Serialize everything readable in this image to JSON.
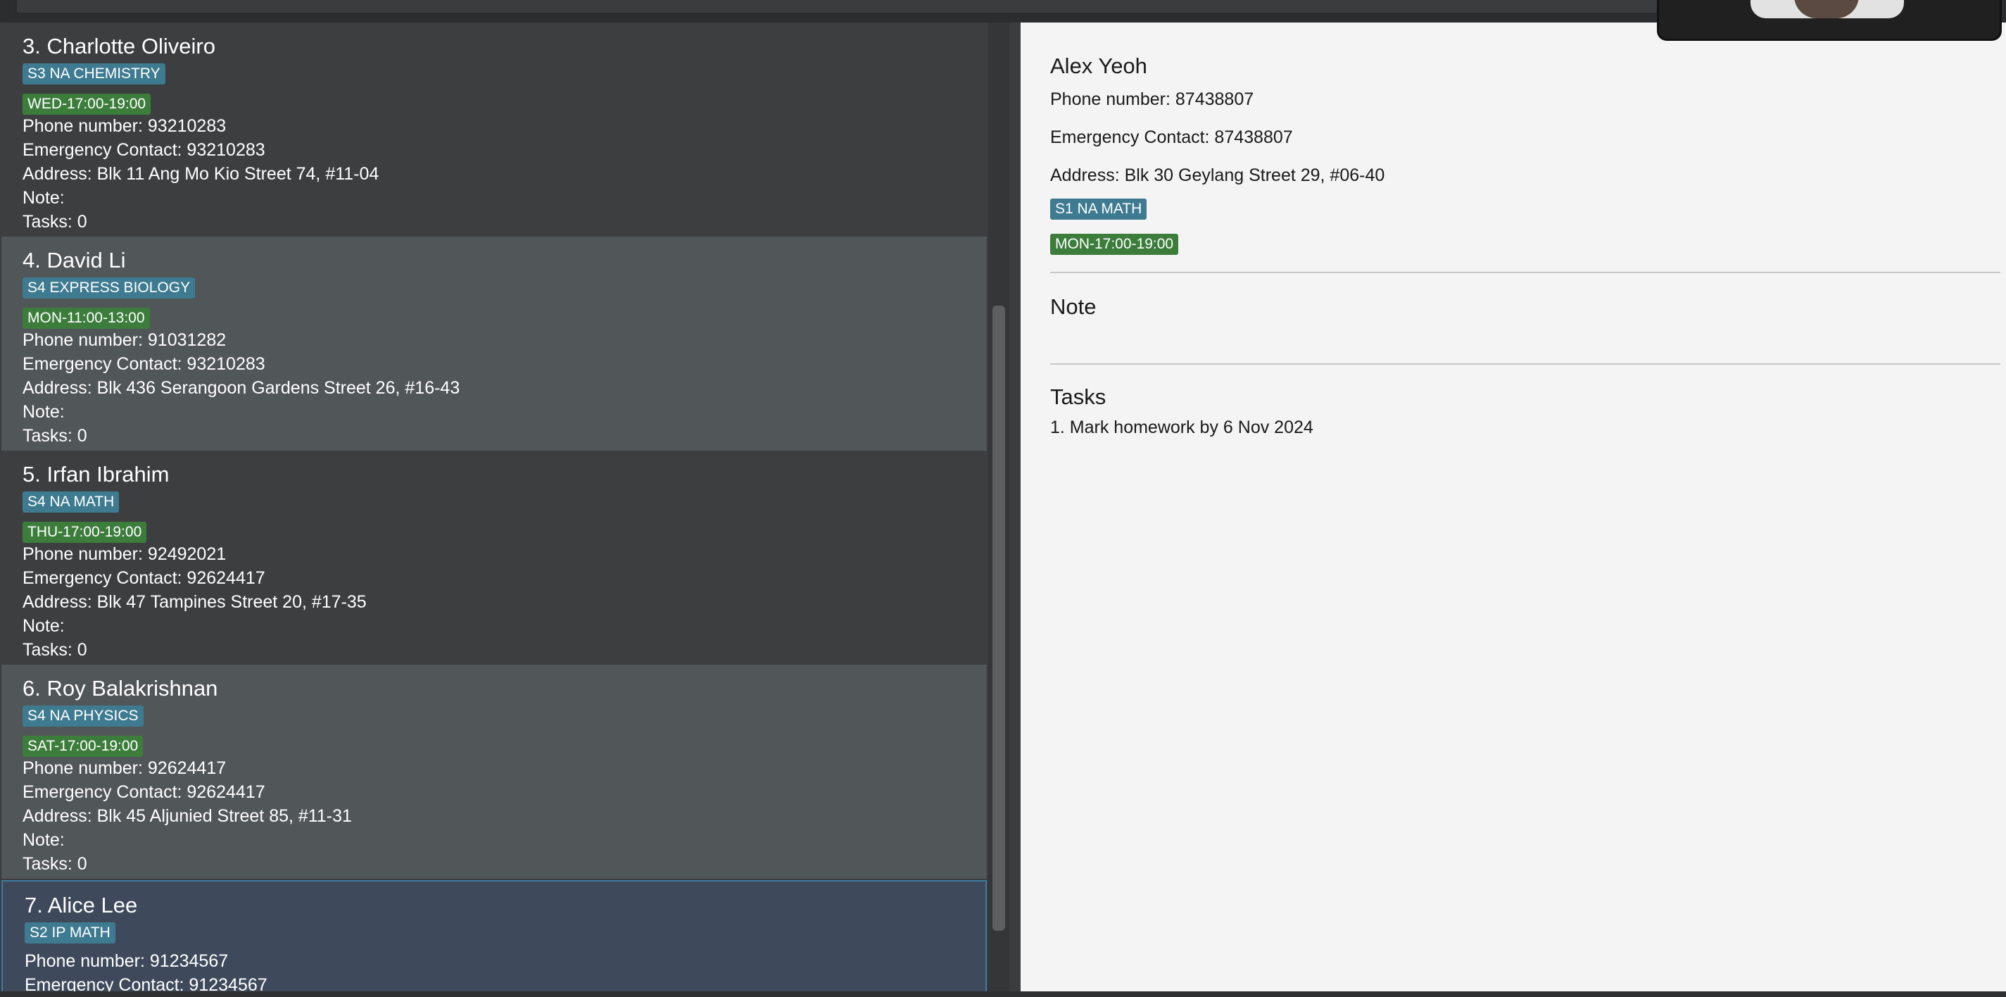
{
  "contacts": [
    {
      "name": "3. Charlotte Oliveiro",
      "subject": "S3 NA CHEMISTRY",
      "slot": "WED-17:00-19:00",
      "phone": "Phone number: 93210283",
      "emergency": "Emergency Contact: 93210283",
      "address": "Address: Blk 11 Ang Mo Kio Street 74, #11-04",
      "note": "Note:",
      "tasks": "Tasks: 0"
    },
    {
      "name": "4. David Li",
      "subject": "S4 EXPRESS BIOLOGY",
      "slot": "MON-11:00-13:00",
      "phone": "Phone number: 91031282",
      "emergency": "Emergency Contact: 93210283",
      "address": "Address: Blk 436 Serangoon Gardens Street 26, #16-43",
      "note": "Note:",
      "tasks": "Tasks: 0"
    },
    {
      "name": "5. Irfan Ibrahim",
      "subject": "S4 NA MATH",
      "slot": "THU-17:00-19:00",
      "phone": "Phone number: 92492021",
      "emergency": "Emergency Contact: 92624417",
      "address": "Address: Blk 47 Tampines Street 20, #17-35",
      "note": "Note:",
      "tasks": "Tasks: 0"
    },
    {
      "name": "6. Roy Balakrishnan",
      "subject": "S4 NA PHYSICS",
      "slot": "SAT-17:00-19:00",
      "phone": "Phone number: 92624417",
      "emergency": "Emergency Contact: 92624417",
      "address": "Address: Blk 45 Aljunied Street 85, #11-31",
      "note": "Note:",
      "tasks": "Tasks: 0"
    },
    {
      "name": "7. Alice Lee",
      "subject": "S2 IP MATH",
      "phone": "Phone number: 91234567",
      "emergency": "Emergency Contact: 91234567"
    }
  ],
  "detail": {
    "name": "Alex Yeoh",
    "phone": "Phone number: 87438807",
    "emergency": "Emergency Contact: 87438807",
    "address": "Address: Blk 30 Geylang Street 29, #06-40",
    "subject": "S1 NA MATH",
    "slot": "MON-17:00-19:00",
    "note_title": "Note",
    "tasks_title": "Tasks",
    "tasks": [
      "1. Mark homework by 6 Nov 2024"
    ]
  },
  "colors": {
    "subject_tag": "#3e7b91",
    "slot_tag": "#3c7d3c",
    "selected_border": "#3d7ca0"
  }
}
